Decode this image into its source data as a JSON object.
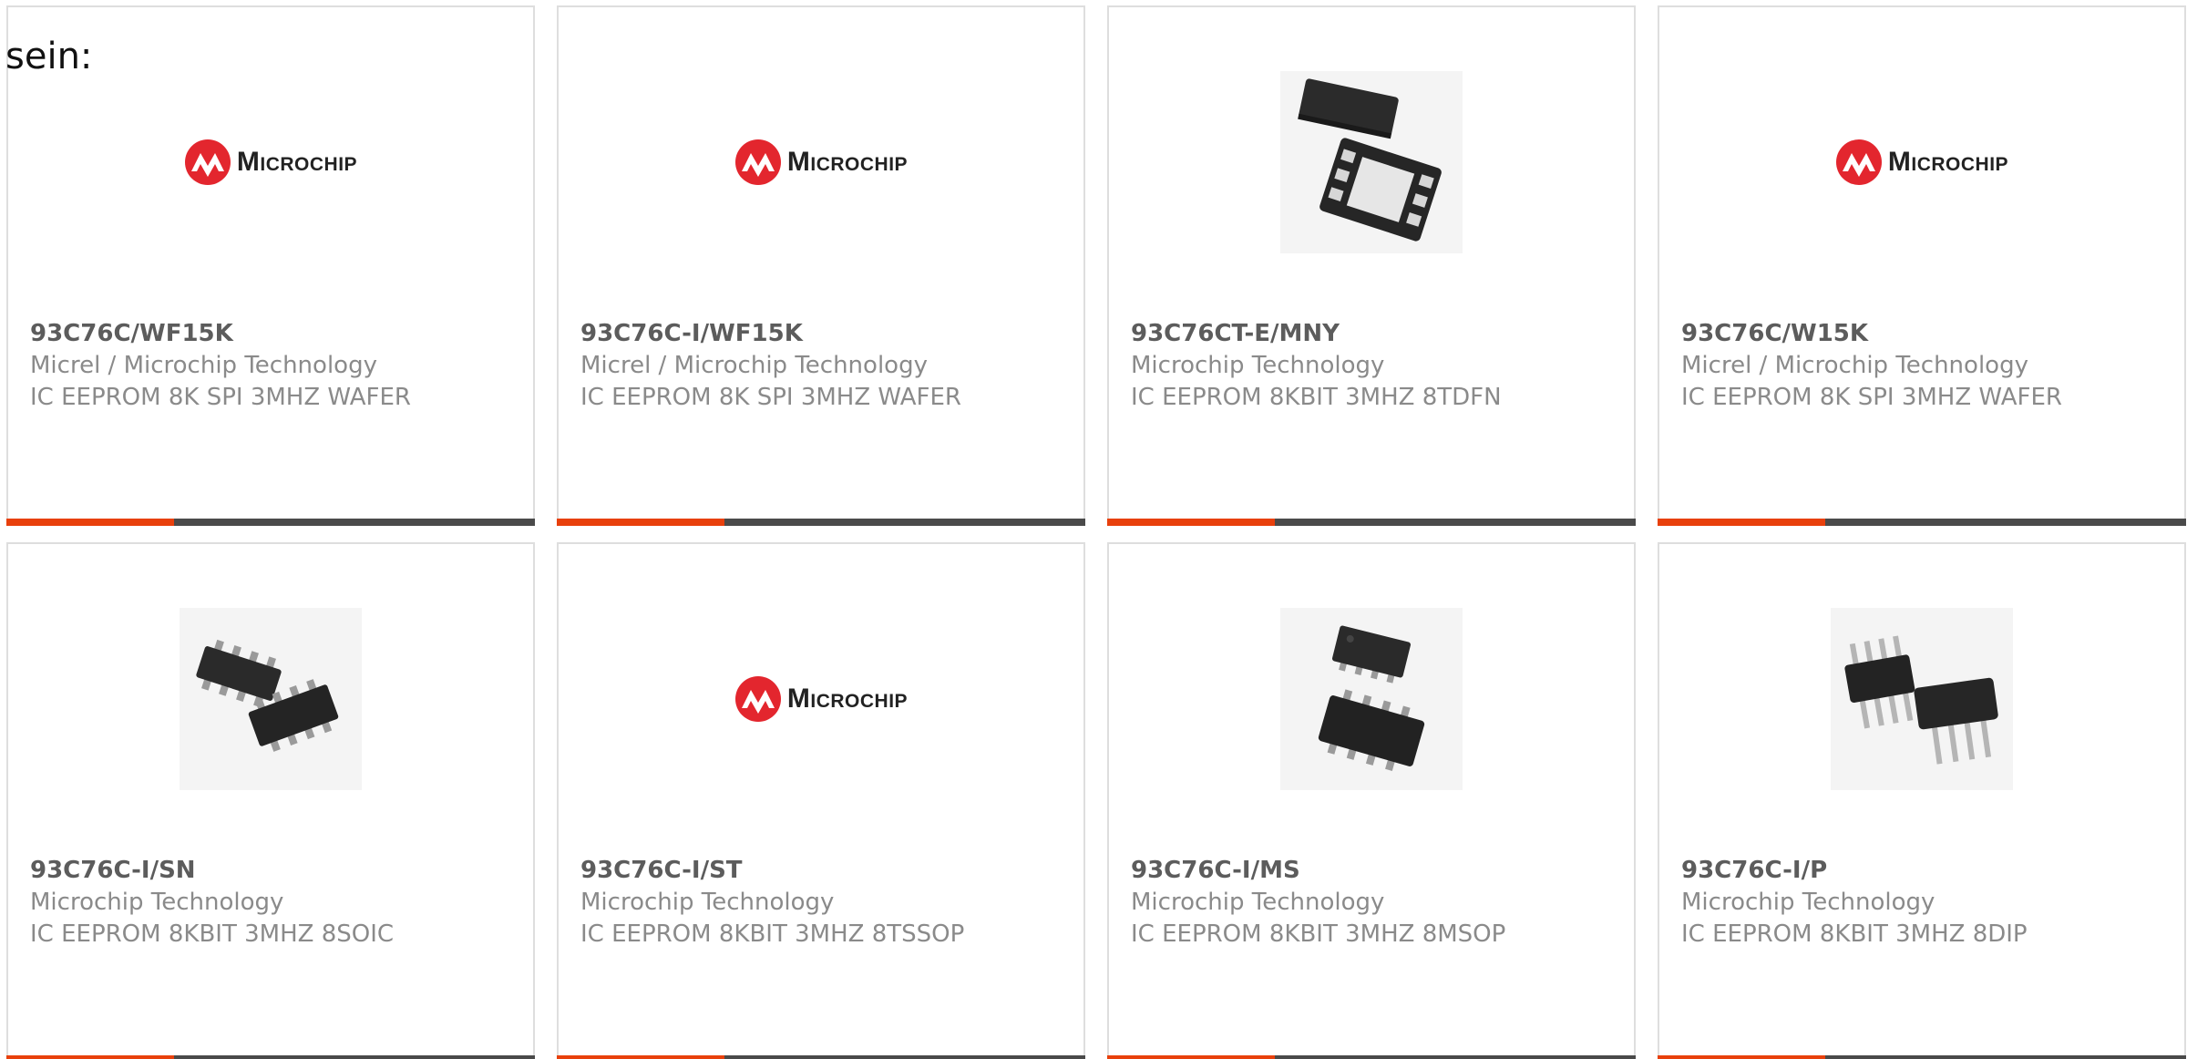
{
  "intro": {
    "text": "sein:"
  },
  "logo": {
    "text": "Microchip"
  },
  "colors": {
    "accent": "#e8400c",
    "bar": "#4a4a4a",
    "logo_red": "#e3262e"
  },
  "products": [
    {
      "part": "93C76C/WF15K",
      "manufacturer": "Micrel / Microchip Technology",
      "description": "IC EEPROM 8K SPI 3MHZ WAFER",
      "image": "microchip-logo"
    },
    {
      "part": "93C76C-I/WF15K",
      "manufacturer": "Micrel / Microchip Technology",
      "description": "IC EEPROM 8K SPI 3MHZ WAFER",
      "image": "microchip-logo"
    },
    {
      "part": "93C76CT-E/MNY",
      "manufacturer": "Microchip Technology",
      "description": "IC EEPROM 8KBIT 3MHZ 8TDFN",
      "image": "tdfn-package"
    },
    {
      "part": "93C76C/W15K",
      "manufacturer": "Micrel / Microchip Technology",
      "description": "IC EEPROM 8K SPI 3MHZ WAFER",
      "image": "microchip-logo"
    },
    {
      "part": "93C76C-I/SN",
      "manufacturer": "Microchip Technology",
      "description": "IC EEPROM 8KBIT 3MHZ 8SOIC",
      "image": "soic-package"
    },
    {
      "part": "93C76C-I/ST",
      "manufacturer": "Microchip Technology",
      "description": "IC EEPROM 8KBIT 3MHZ 8TSSOP",
      "image": "microchip-logo"
    },
    {
      "part": "93C76C-I/MS",
      "manufacturer": "Microchip Technology",
      "description": "IC EEPROM 8KBIT 3MHZ 8MSOP",
      "image": "msop-package"
    },
    {
      "part": "93C76C-I/P",
      "manufacturer": "Microchip Technology",
      "description": "IC EEPROM 8KBIT 3MHZ 8DIP",
      "image": "dip-package"
    }
  ]
}
